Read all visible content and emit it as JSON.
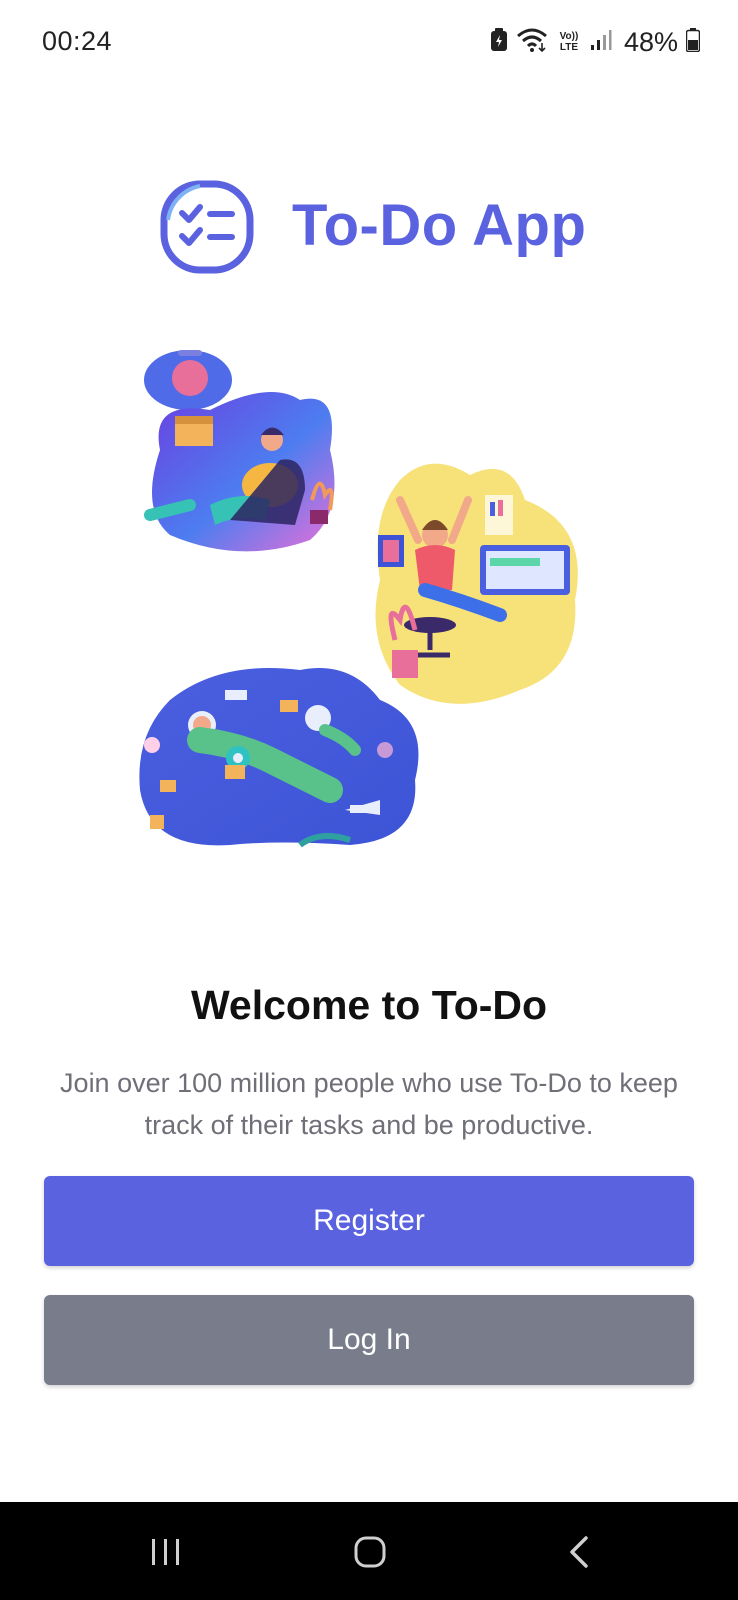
{
  "status_bar": {
    "time": "00:24",
    "battery": "48%",
    "network_label": "Vo)) LTE",
    "icons": [
      "battery-saver-icon",
      "wifi-icon",
      "volte-icon",
      "signal-icon",
      "battery-icon"
    ]
  },
  "header": {
    "app_title": "To-Do App",
    "logo_icon": "checklist-icon",
    "brand_color": "#5b62e0"
  },
  "main": {
    "welcome_title": "Welcome to To-Do",
    "welcome_subtitle": "Join over 100 million people who use To-Do to keep track of their tasks and be productive."
  },
  "actions": {
    "register_label": "Register",
    "register_color": "#5b62e0",
    "login_label": "Log In",
    "login_color": "#787c8b"
  },
  "nav_bar": {
    "icons": [
      "recent-apps-icon",
      "home-icon",
      "back-icon"
    ]
  }
}
